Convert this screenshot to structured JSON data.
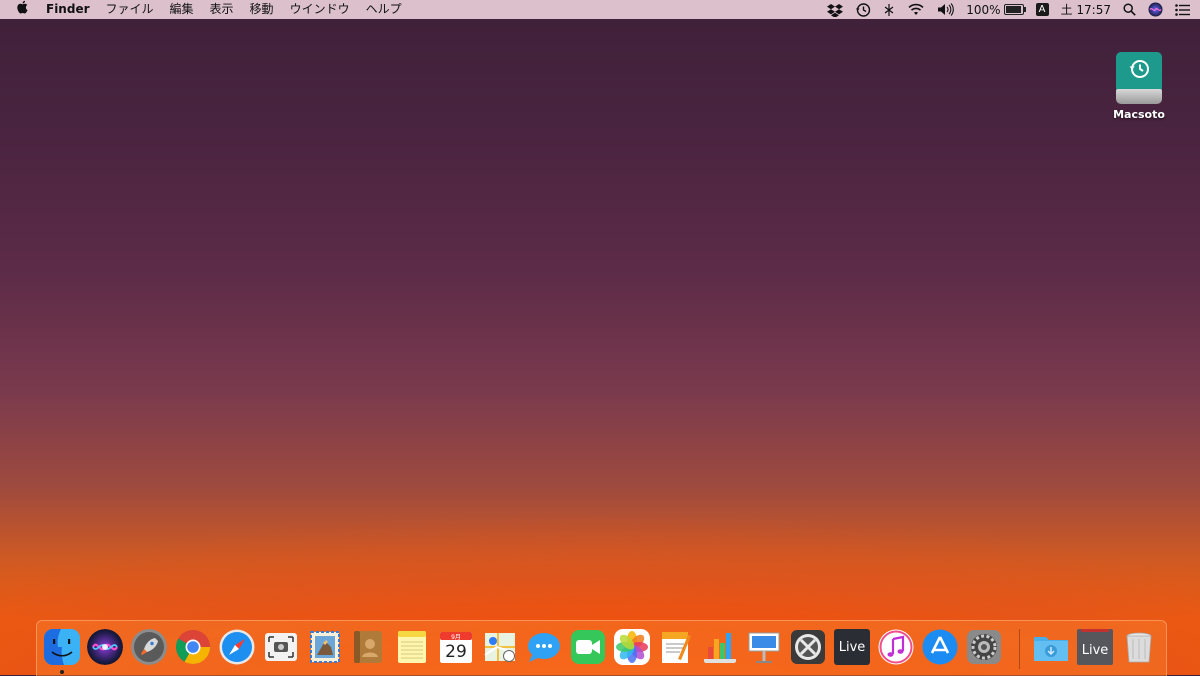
{
  "menubar": {
    "apple_icon": "apple-icon",
    "app_name": "Finder",
    "menus": [
      "ファイル",
      "編集",
      "表示",
      "移動",
      "ウインドウ",
      "ヘルプ"
    ],
    "battery": "100%",
    "input_method": "A",
    "clock": "土 17:57"
  },
  "desktop": {
    "drive_label": "Macsoto"
  },
  "dock": {
    "apps": [
      {
        "name": "Finder",
        "icon": "finder-icon"
      },
      {
        "name": "Siri",
        "icon": "siri-icon"
      },
      {
        "name": "Launchpad",
        "icon": "launchpad-icon"
      },
      {
        "name": "Chrome",
        "icon": "chrome-icon"
      },
      {
        "name": "Safari",
        "icon": "safari-icon"
      },
      {
        "name": "Screenshot",
        "icon": "screenshot-icon"
      },
      {
        "name": "Mail",
        "icon": "mail-icon"
      },
      {
        "name": "Contacts",
        "icon": "contacts-icon"
      },
      {
        "name": "Notes",
        "icon": "notes-icon"
      },
      {
        "name": "Calendar",
        "icon": "calendar-icon",
        "month": "9月",
        "day": "29"
      },
      {
        "name": "Maps",
        "icon": "maps-icon"
      },
      {
        "name": "Messages",
        "icon": "messages-icon"
      },
      {
        "name": "FaceTime",
        "icon": "facetime-icon"
      },
      {
        "name": "Photos",
        "icon": "photos-icon"
      },
      {
        "name": "Pages",
        "icon": "pages-icon"
      },
      {
        "name": "Numbers",
        "icon": "numbers-icon"
      },
      {
        "name": "Keynote",
        "icon": "keynote-icon"
      },
      {
        "name": "Boot Camp",
        "icon": "bootcamp-icon"
      },
      {
        "name": "Live",
        "icon": "live-icon",
        "text": "Live"
      },
      {
        "name": "iTunes",
        "icon": "itunes-icon"
      },
      {
        "name": "App Store",
        "icon": "appstore-icon"
      },
      {
        "name": "System Preferences",
        "icon": "system-preferences-icon"
      },
      {
        "name": "Downloads",
        "icon": "downloads-folder-icon"
      },
      {
        "name": "Live",
        "icon": "live-stack-icon",
        "text": "Live"
      },
      {
        "name": "Trash",
        "icon": "trash-icon"
      }
    ]
  }
}
